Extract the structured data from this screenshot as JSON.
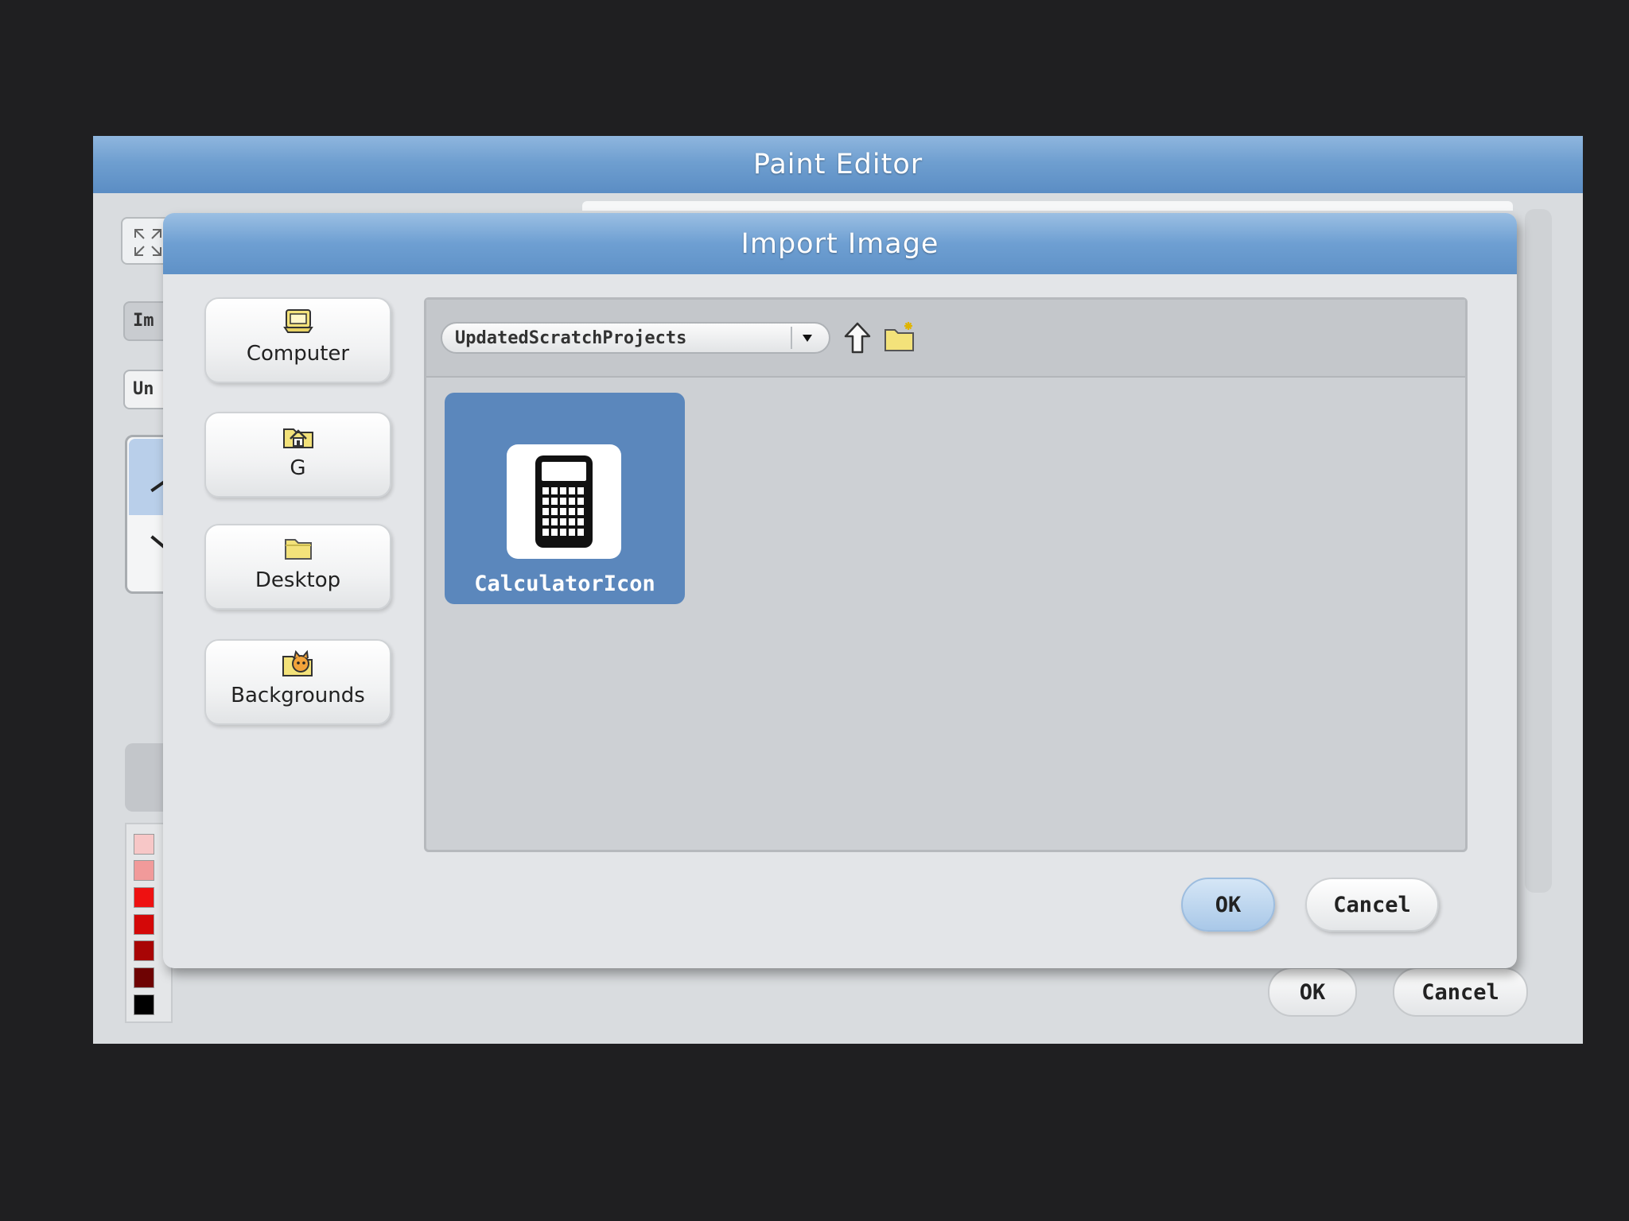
{
  "paint_editor": {
    "title": "Paint Editor",
    "import_button_label": "Im",
    "undo_button_label": "Un",
    "ok_label": "OK",
    "cancel_label": "Cancel",
    "palette_colors": [
      "#f7c7c7",
      "#f19a9a",
      "#ee1111",
      "#d40808",
      "#a80505",
      "#6e0303",
      "#000000"
    ]
  },
  "import_dialog": {
    "title": "Import Image",
    "places": [
      {
        "label": "Computer",
        "icon": "computer-icon"
      },
      {
        "label": "G",
        "icon": "home-folder-icon"
      },
      {
        "label": "Desktop",
        "icon": "folder-icon"
      },
      {
        "label": "Backgrounds",
        "icon": "scratch-cat-folder-icon"
      }
    ],
    "current_folder": "UpdatedScratchProjects",
    "files": [
      {
        "name": "CalculatorIcon",
        "icon": "calculator-icon",
        "selected": true
      }
    ],
    "ok_label": "OK",
    "cancel_label": "Cancel",
    "colors": {
      "title_bar": "#6e9fd2",
      "selection": "#5b87bc"
    }
  }
}
